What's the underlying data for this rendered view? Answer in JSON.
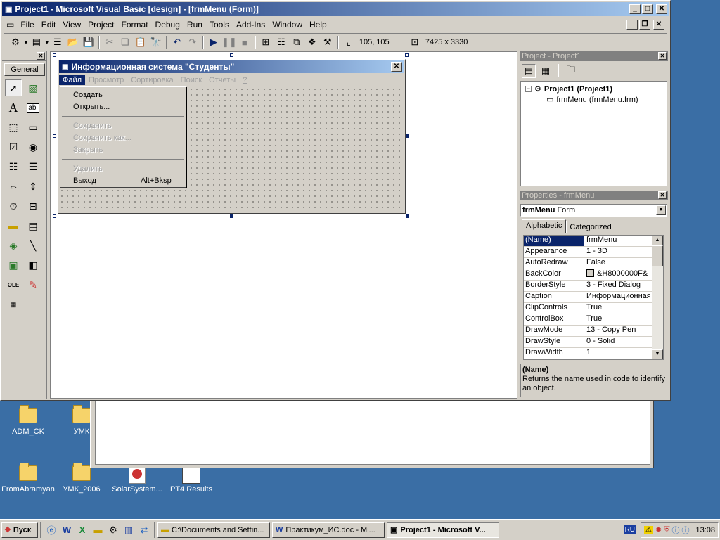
{
  "window": {
    "title": "Project1 - Microsoft Visual Basic [design] - [frmMenu (Form)]"
  },
  "menubar": [
    "File",
    "Edit",
    "View",
    "Project",
    "Format",
    "Debug",
    "Run",
    "Tools",
    "Add-Ins",
    "Window",
    "Help"
  ],
  "toolbar": {
    "position": "105, 105",
    "size": "7425 x 3330"
  },
  "toolbox": {
    "tab": "General"
  },
  "form": {
    "title": "Информационная система \"Студенты\"",
    "menu": [
      "Файл",
      "Просмотр",
      "Сортировка",
      "Поиск",
      "Отчеты",
      "?"
    ],
    "dropdown": [
      {
        "label": "Создать",
        "disabled": false
      },
      {
        "label": "Открыть...",
        "disabled": false
      },
      {
        "sep": true
      },
      {
        "label": "Сохранить",
        "disabled": true
      },
      {
        "label": "Сохранить как...",
        "disabled": true
      },
      {
        "label": "Закрыть",
        "disabled": true
      },
      {
        "sep": true
      },
      {
        "label": "Удалить",
        "disabled": true
      },
      {
        "label": "Выход",
        "shortcut": "Alt+Bksp",
        "disabled": false
      }
    ]
  },
  "project_panel": {
    "title": "Project - Project1",
    "root": "Project1 (Project1)",
    "child": "frmMenu (frmMenu.frm)"
  },
  "properties": {
    "title": "Properties - frmMenu",
    "object": "frmMenu",
    "object_type": "Form",
    "tabs": [
      "Alphabetic",
      "Categorized"
    ],
    "rows": [
      {
        "name": "(Name)",
        "value": "frmMenu"
      },
      {
        "name": "Appearance",
        "value": "1 - 3D"
      },
      {
        "name": "AutoRedraw",
        "value": "False"
      },
      {
        "name": "BackColor",
        "value": "&H8000000F&"
      },
      {
        "name": "BorderStyle",
        "value": "3 - Fixed Dialog"
      },
      {
        "name": "Caption",
        "value": "Информационная с"
      },
      {
        "name": "ClipControls",
        "value": "True"
      },
      {
        "name": "ControlBox",
        "value": "True"
      },
      {
        "name": "DrawMode",
        "value": "13 - Copy Pen"
      },
      {
        "name": "DrawStyle",
        "value": "0 - Solid"
      },
      {
        "name": "DrawWidth",
        "value": "1"
      }
    ],
    "desc_title": "(Name)",
    "desc_text": "Returns the name used in code to identify an object."
  },
  "desktop_icons": [
    {
      "label": "ADM_CK"
    },
    {
      "label": "УМК"
    },
    {
      "label": "FromAbramyan"
    },
    {
      "label": "УМК_2006"
    },
    {
      "label": "SolarSystem..."
    },
    {
      "label": "PT4 Results"
    }
  ],
  "taskbar": {
    "start": "Пуск",
    "tasks": [
      "C:\\Documents and Settin...",
      "Практикум_ИС.doc - Mi...",
      "Project1 - Microsoft V..."
    ],
    "lang": "RU",
    "clock": "13:08"
  },
  "colors": {
    "desktop": "#3a6ea5",
    "titlebar": "#0a246a",
    "selection": "#0a246a"
  }
}
